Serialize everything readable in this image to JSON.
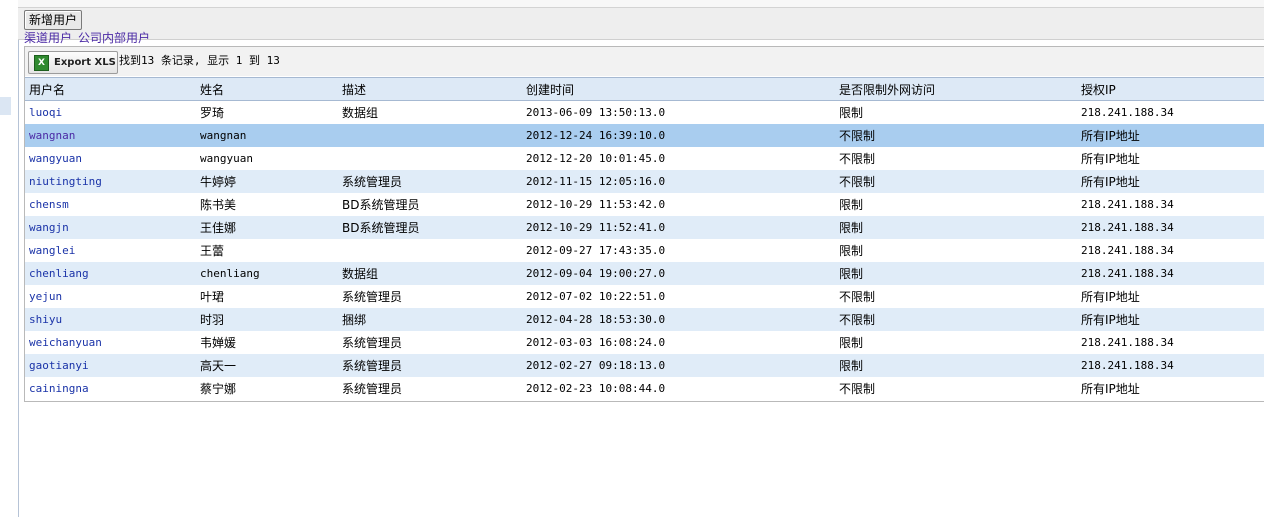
{
  "toolbar": {
    "add_user_label": "新增用户"
  },
  "links": {
    "channel_users": "渠道用户",
    "internal_users": "公司内部用户"
  },
  "export": {
    "label": "Export XLS",
    "icon": "excel-icon"
  },
  "records": {
    "summary": "找到13 条记录, 显示 1 到 13"
  },
  "table": {
    "columns": [
      "用户名",
      "姓名",
      "描述",
      "创建时间",
      "是否限制外网访问",
      "授权IP"
    ],
    "selected_index": 1,
    "rows": [
      {
        "username": "luoqi",
        "name": "罗琦",
        "desc": "数据组",
        "created": "2013-06-09 13:50:13.0",
        "restricted": "限制",
        "ip": "218.241.188.34"
      },
      {
        "username": "wangnan",
        "name": "wangnan",
        "desc": "",
        "created": "2012-12-24 16:39:10.0",
        "restricted": "不限制",
        "ip": "所有IP地址"
      },
      {
        "username": "wangyuan",
        "name": "wangyuan",
        "desc": "",
        "created": "2012-12-20 10:01:45.0",
        "restricted": "不限制",
        "ip": "所有IP地址"
      },
      {
        "username": "niutingting",
        "name": "牛婷婷",
        "desc": "系统管理员",
        "created": "2012-11-15 12:05:16.0",
        "restricted": "不限制",
        "ip": "所有IP地址"
      },
      {
        "username": "chensm",
        "name": "陈书美",
        "desc": "BD系统管理员",
        "created": "2012-10-29 11:53:42.0",
        "restricted": "限制",
        "ip": "218.241.188.34"
      },
      {
        "username": "wangjn",
        "name": "王佳娜",
        "desc": "BD系统管理员",
        "created": "2012-10-29 11:52:41.0",
        "restricted": "限制",
        "ip": "218.241.188.34"
      },
      {
        "username": "wanglei",
        "name": "王蕾",
        "desc": "",
        "created": "2012-09-27 17:43:35.0",
        "restricted": "限制",
        "ip": "218.241.188.34"
      },
      {
        "username": "chenliang",
        "name": "chenliang",
        "desc": "数据组",
        "created": "2012-09-04 19:00:27.0",
        "restricted": "限制",
        "ip": "218.241.188.34"
      },
      {
        "username": "yejun",
        "name": "叶珺",
        "desc": "系统管理员",
        "created": "2012-07-02 10:22:51.0",
        "restricted": "不限制",
        "ip": "所有IP地址"
      },
      {
        "username": "shiyu",
        "name": "时羽",
        "desc": "捆绑",
        "created": "2012-04-28 18:53:30.0",
        "restricted": "不限制",
        "ip": "所有IP地址"
      },
      {
        "username": "weichanyuan",
        "name": "韦婵媛",
        "desc": "系统管理员",
        "created": "2012-03-03 16:08:24.0",
        "restricted": "限制",
        "ip": "218.241.188.34"
      },
      {
        "username": "gaotianyi",
        "name": "高天一",
        "desc": "系统管理员",
        "created": "2012-02-27 09:18:13.0",
        "restricted": "限制",
        "ip": "218.241.188.34"
      },
      {
        "username": "cainingna",
        "name": "蔡宁娜",
        "desc": "系统管理员",
        "created": "2012-02-23 10:08:44.0",
        "restricted": "不限制",
        "ip": "所有IP地址"
      }
    ]
  },
  "colors": {
    "header_bg": "#dde9f6",
    "row_alt": "#e0ecf8",
    "row_selected": "#a9cdef",
    "link": "#1a33a8",
    "visited_link": "#4b2aa5"
  }
}
